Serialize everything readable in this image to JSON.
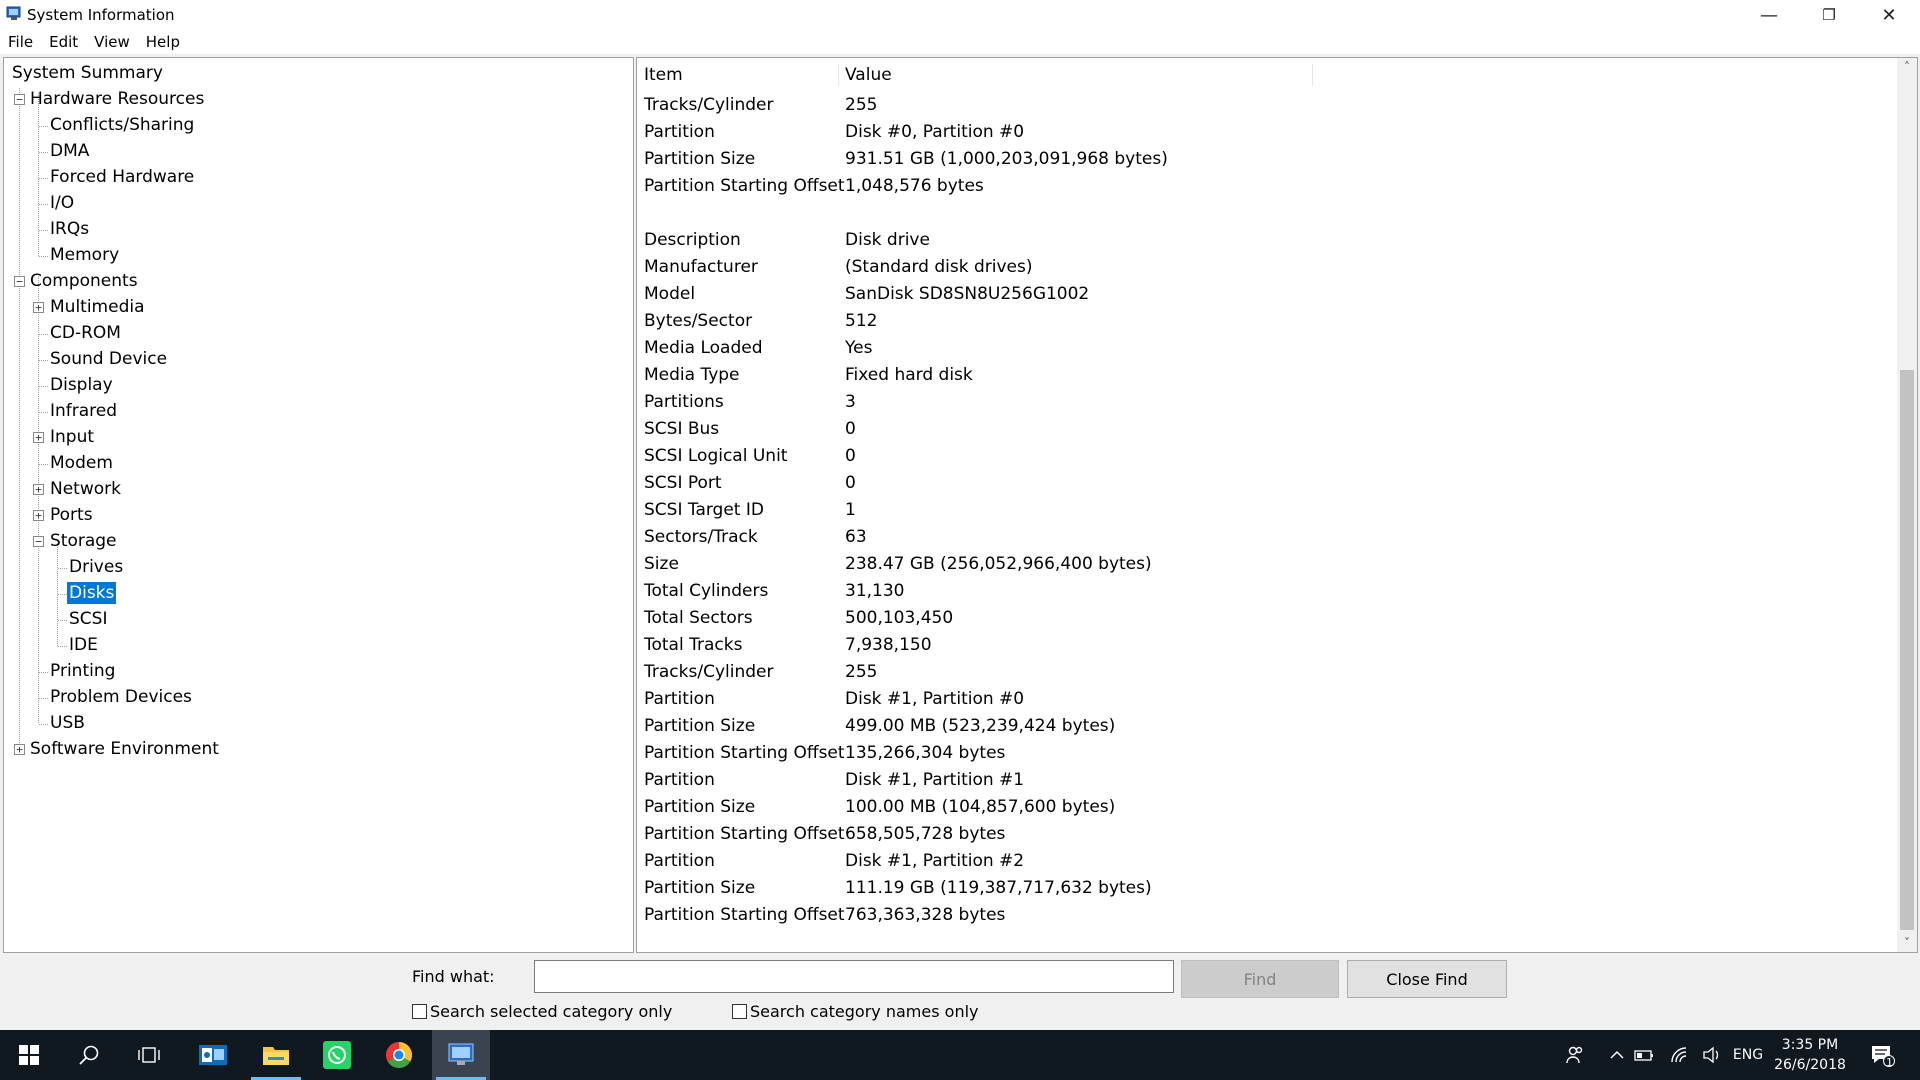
{
  "window": {
    "title": "System Information",
    "controls": {
      "minimize": "—",
      "maximize": "❐",
      "close": "✕"
    }
  },
  "menu": [
    "File",
    "Edit",
    "View",
    "Help"
  ],
  "tree": [
    {
      "label": "System Summary",
      "level": 0,
      "expander": "",
      "selected": false
    },
    {
      "label": "Hardware Resources",
      "level": 0,
      "expander": "minus",
      "selected": false
    },
    {
      "label": "Conflicts/Sharing",
      "level": 1,
      "expander": "",
      "selected": false
    },
    {
      "label": "DMA",
      "level": 1,
      "expander": "",
      "selected": false
    },
    {
      "label": "Forced Hardware",
      "level": 1,
      "expander": "",
      "selected": false
    },
    {
      "label": "I/O",
      "level": 1,
      "expander": "",
      "selected": false
    },
    {
      "label": "IRQs",
      "level": 1,
      "expander": "",
      "selected": false
    },
    {
      "label": "Memory",
      "level": 1,
      "expander": "",
      "selected": false
    },
    {
      "label": "Components",
      "level": 0,
      "expander": "minus",
      "selected": false
    },
    {
      "label": "Multimedia",
      "level": 1,
      "expander": "plus",
      "selected": false
    },
    {
      "label": "CD-ROM",
      "level": 1,
      "expander": "",
      "selected": false
    },
    {
      "label": "Sound Device",
      "level": 1,
      "expander": "",
      "selected": false
    },
    {
      "label": "Display",
      "level": 1,
      "expander": "",
      "selected": false
    },
    {
      "label": "Infrared",
      "level": 1,
      "expander": "",
      "selected": false
    },
    {
      "label": "Input",
      "level": 1,
      "expander": "plus",
      "selected": false
    },
    {
      "label": "Modem",
      "level": 1,
      "expander": "",
      "selected": false
    },
    {
      "label": "Network",
      "level": 1,
      "expander": "plus",
      "selected": false
    },
    {
      "label": "Ports",
      "level": 1,
      "expander": "plus",
      "selected": false
    },
    {
      "label": "Storage",
      "level": 1,
      "expander": "minus",
      "selected": false
    },
    {
      "label": "Drives",
      "level": 2,
      "expander": "",
      "selected": false
    },
    {
      "label": "Disks",
      "level": 2,
      "expander": "",
      "selected": true
    },
    {
      "label": "SCSI",
      "level": 2,
      "expander": "",
      "selected": false
    },
    {
      "label": "IDE",
      "level": 2,
      "expander": "",
      "selected": false
    },
    {
      "label": "Printing",
      "level": 1,
      "expander": "",
      "selected": false
    },
    {
      "label": "Problem Devices",
      "level": 1,
      "expander": "",
      "selected": false
    },
    {
      "label": "USB",
      "level": 1,
      "expander": "",
      "selected": false
    },
    {
      "label": "Software Environment",
      "level": 0,
      "expander": "plus",
      "selected": false
    }
  ],
  "details": {
    "columns": [
      "Item",
      "Value"
    ],
    "rows": [
      [
        "Tracks/Cylinder",
        "255"
      ],
      [
        "Partition",
        "Disk #0, Partition #0"
      ],
      [
        "Partition Size",
        "931.51 GB (1,000,203,091,968 bytes)"
      ],
      [
        "Partition Starting Offset",
        "1,048,576 bytes"
      ],
      [
        "",
        ""
      ],
      [
        "Description",
        "Disk drive"
      ],
      [
        "Manufacturer",
        "(Standard disk drives)"
      ],
      [
        "Model",
        "SanDisk SD8SN8U256G1002"
      ],
      [
        "Bytes/Sector",
        "512"
      ],
      [
        "Media Loaded",
        "Yes"
      ],
      [
        "Media Type",
        "Fixed hard disk"
      ],
      [
        "Partitions",
        "3"
      ],
      [
        "SCSI Bus",
        "0"
      ],
      [
        "SCSI Logical Unit",
        "0"
      ],
      [
        "SCSI Port",
        "0"
      ],
      [
        "SCSI Target ID",
        "1"
      ],
      [
        "Sectors/Track",
        "63"
      ],
      [
        "Size",
        "238.47 GB (256,052,966,400 bytes)"
      ],
      [
        "Total Cylinders",
        "31,130"
      ],
      [
        "Total Sectors",
        "500,103,450"
      ],
      [
        "Total Tracks",
        "7,938,150"
      ],
      [
        "Tracks/Cylinder",
        "255"
      ],
      [
        "Partition",
        "Disk #1, Partition #0"
      ],
      [
        "Partition Size",
        "499.00 MB (523,239,424 bytes)"
      ],
      [
        "Partition Starting Offset",
        "135,266,304 bytes"
      ],
      [
        "Partition",
        "Disk #1, Partition #1"
      ],
      [
        "Partition Size",
        "100.00 MB (104,857,600 bytes)"
      ],
      [
        "Partition Starting Offset",
        "658,505,728 bytes"
      ],
      [
        "Partition",
        "Disk #1, Partition #2"
      ],
      [
        "Partition Size",
        "111.19 GB (119,387,717,632 bytes)"
      ],
      [
        "Partition Starting Offset",
        "763,363,328 bytes"
      ]
    ]
  },
  "find": {
    "label": "Find what:",
    "value": "",
    "find_button": "Find",
    "close_button": "Close Find",
    "check_selected": "Search selected category only",
    "check_names": "Search category names only"
  },
  "taskbar": {
    "language": "ENG",
    "time": "3:35 PM",
    "date": "26/6/2018",
    "notification_count": "1",
    "icons": [
      "windows-start-icon",
      "search-icon",
      "task-view-icon",
      "outlook-icon",
      "file-explorer-icon",
      "whatsapp-icon",
      "chrome-icon",
      "system-information-icon"
    ]
  },
  "colors": {
    "selection": "#0078d7",
    "taskbar": "#101820",
    "accent_line": "#76b9ed"
  }
}
